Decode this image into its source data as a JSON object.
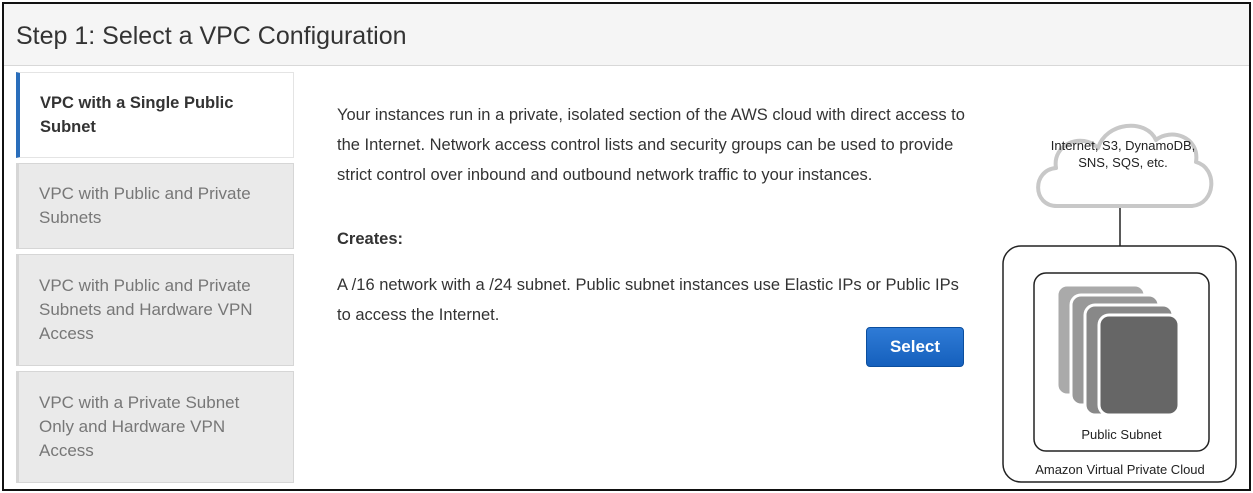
{
  "header": {
    "title": "Step 1: Select a VPC Configuration"
  },
  "sidebar": {
    "items": [
      {
        "label": "VPC with a Single Public Subnet",
        "active": true
      },
      {
        "label": "VPC with Public and Private Subnets",
        "active": false
      },
      {
        "label": "VPC with Public and Private Subnets and Hardware VPN Access",
        "active": false
      },
      {
        "label": "VPC with a Private Subnet Only and Hardware VPN Access",
        "active": false
      }
    ]
  },
  "main": {
    "description": "Your instances run in a private, isolated section of the AWS cloud with direct access to the Internet. Network access control lists and security groups can be used to provide strict control over inbound and outbound network traffic to your instances.",
    "creates_label": "Creates:",
    "creates_text": "A /16 network with a /24 subnet. Public subnet instances use Elastic IPs or Public IPs to access the Internet.",
    "select_label": "Select"
  },
  "diagram": {
    "cloud_text": "Internet, S3, DynamoDB, SNS, SQS, etc.",
    "subnet_label": "Public Subnet",
    "vpc_label": "Amazon Virtual Private Cloud"
  },
  "colors": {
    "accent": "#2a6ebb",
    "button": "#1a67c8",
    "cloud_stroke": "#c8c8c8",
    "instance_fill": "#666666"
  }
}
